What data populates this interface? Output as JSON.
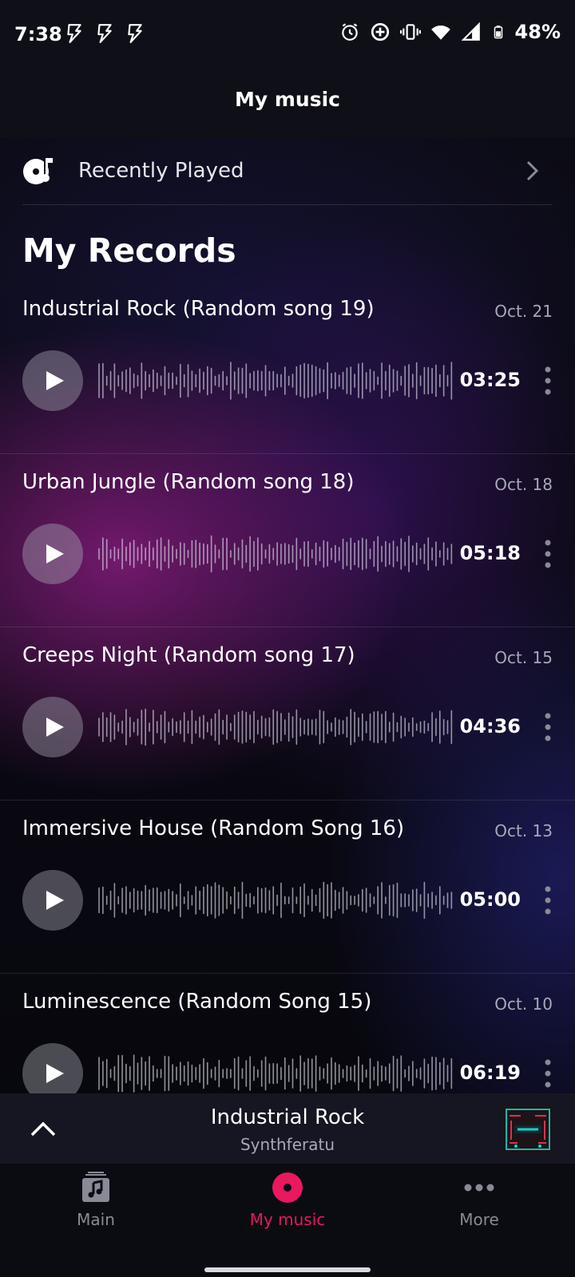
{
  "status_bar": {
    "time": "7:38",
    "battery": "48%"
  },
  "header": {
    "title": "My music"
  },
  "recently_played": {
    "label": "Recently Played"
  },
  "section": {
    "title": "My Records"
  },
  "records": [
    {
      "title": "Industrial Rock (Random song 19)",
      "date": "Oct. 21",
      "duration": "03:25"
    },
    {
      "title": "Urban Jungle (Random song 18)",
      "date": "Oct. 18",
      "duration": "05:18"
    },
    {
      "title": "Creeps Night (Random song 17)",
      "date": "Oct. 15",
      "duration": "04:36"
    },
    {
      "title": "Immersive House (Random Song 16)",
      "date": "Oct. 13",
      "duration": "05:00"
    },
    {
      "title": "Luminescence (Random Song 15)",
      "date": "Oct. 10",
      "duration": "06:19"
    }
  ],
  "player": {
    "song": "Industrial Rock",
    "artist": "Synthferatu"
  },
  "nav": {
    "items": [
      {
        "label": "Main",
        "icon": "music-note-icon"
      },
      {
        "label": "My music",
        "icon": "record-icon",
        "active": true
      },
      {
        "label": "More",
        "icon": "more-dots-icon"
      }
    ]
  },
  "colors": {
    "accent": "#e8195e",
    "background": "#0a0a12"
  }
}
